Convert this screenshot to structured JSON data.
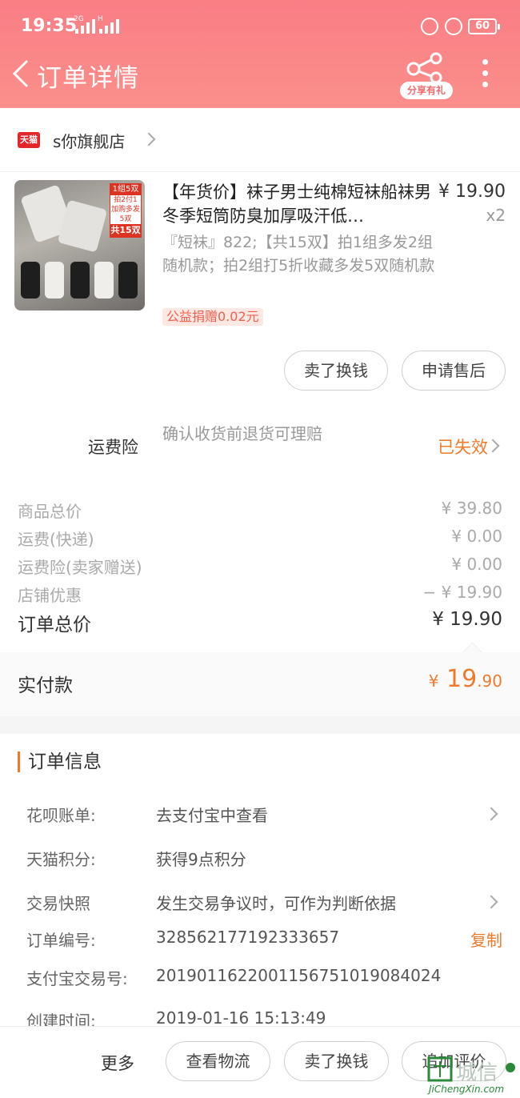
{
  "status_bar": {
    "time": "19:35",
    "network_left": "2G",
    "network_right": "H",
    "battery": "60"
  },
  "header": {
    "title": "订单详情",
    "share_label": "分享有礼"
  },
  "shop": {
    "badge": "天猫",
    "name": "s你旗舰店"
  },
  "product": {
    "title": "【年货价】袜子男士纯棉短袜船袜男冬季短筒防臭加厚吸汗低…",
    "price": "¥ 19.90",
    "quantity": "x2",
    "sku": "『短袜』822;【共15双】拍1组多发2组随机款；拍2组打5折收藏多发5双随机款",
    "charity": "公益捐赠0.02元",
    "thumb_tag": {
      "line1": "1组5双",
      "line2": "拍2付1",
      "line3": "加购多发5双",
      "line4": "共15双"
    }
  },
  "item_actions": {
    "sell_button": "卖了换钱",
    "after_sale_button": "申请售后"
  },
  "insurance": {
    "label": "运费险",
    "description": "确认收货前退货可理赔",
    "status": "已失效"
  },
  "fees": [
    {
      "label": "商品总价",
      "value": "¥ 39.80"
    },
    {
      "label": "运费(快递)",
      "value": "¥ 0.00"
    },
    {
      "label": "运费险(卖家赠送)",
      "value": "¥ 0.00"
    },
    {
      "label": "店铺优惠",
      "value": "− ¥ 19.90"
    }
  ],
  "total": {
    "label": "订单总价",
    "value": "¥ 19.90"
  },
  "paid": {
    "label": "实付款",
    "currency": "¥",
    "integer": "19",
    "decimal": ".90"
  },
  "order_info": {
    "title": "订单信息",
    "rows": [
      {
        "label": "花呗账单:",
        "value": "去支付宝中查看"
      },
      {
        "label": "天猫积分:",
        "value": "获得9点积分"
      },
      {
        "label": "交易快照",
        "value": "发生交易争议时，可作为判断依据"
      },
      {
        "label": "订单编号:",
        "value": "328562177192333657"
      },
      {
        "label": "支付宝交易号:",
        "value": "2019011622001156751019084024"
      },
      {
        "label": "创建时间:",
        "value": "2019-01-16 15:13:49"
      }
    ],
    "copy_label": "复制"
  },
  "bottom_bar": {
    "more": "更多",
    "logistics": "查看物流",
    "sell": "卖了换钱",
    "review": "追加评价"
  },
  "watermark": {
    "text_cn": "城信",
    "text_en": "JiChengXin.com"
  },
  "colors": {
    "header": "#f97e85",
    "accent": "#f07a2c",
    "tmall": "#e4262b"
  }
}
